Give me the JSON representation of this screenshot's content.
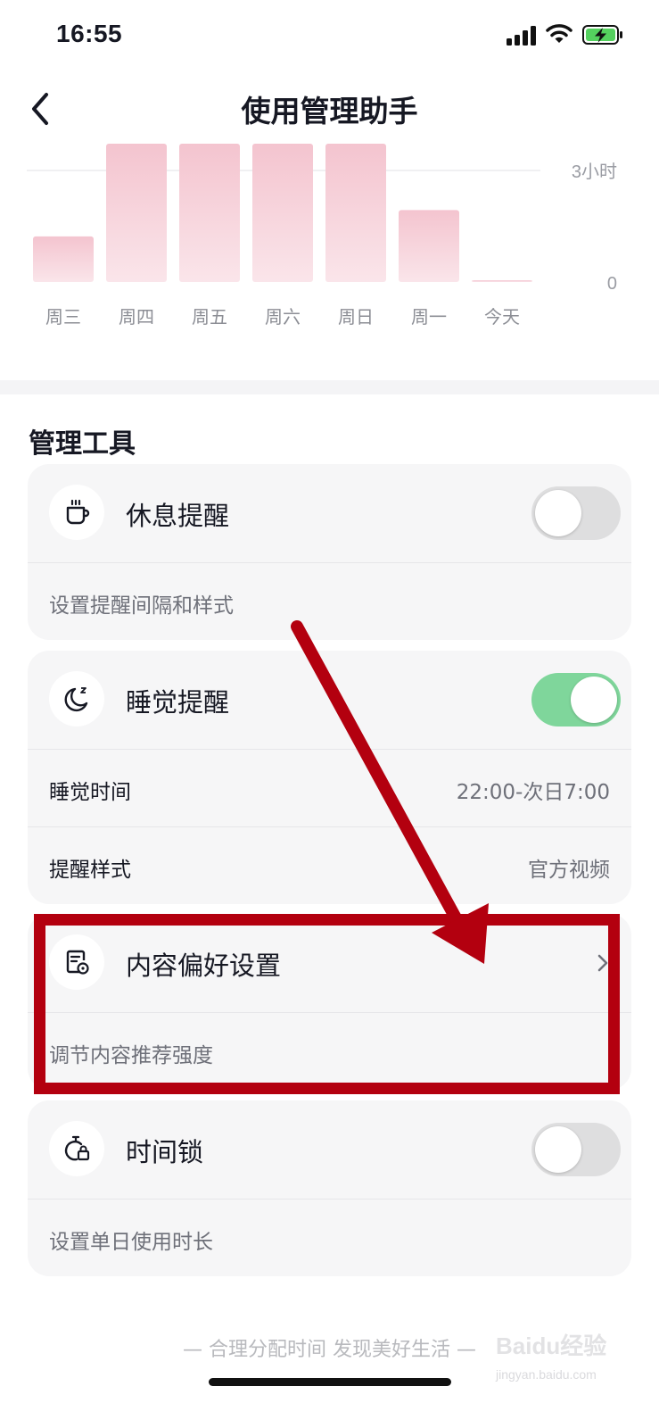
{
  "status_bar": {
    "time": "16:55"
  },
  "nav": {
    "title": "使用管理助手"
  },
  "usage_chart": {
    "y_max_label": "3小时",
    "y_min_label": "0",
    "days": [
      "周三",
      "周四",
      "周五",
      "周六",
      "周日",
      "周一",
      "今天"
    ],
    "values": [
      0.33,
      1.0,
      1.0,
      1.0,
      1.0,
      0.52,
      0.01
    ],
    "bar_color": "#f4c9d3"
  },
  "section": {
    "title": "管理工具"
  },
  "rest_reminder": {
    "title": "休息提醒",
    "subtitle": "设置提醒间隔和样式",
    "enabled": false
  },
  "sleep_reminder": {
    "title": "睡觉提醒",
    "enabled": true,
    "sleep_time_label": "睡觉时间",
    "sleep_time_value": "22:00-次日7:00",
    "style_label": "提醒样式",
    "style_value": "官方视频"
  },
  "content_pref": {
    "title": "内容偏好设置",
    "subtitle": "调节内容推荐强度"
  },
  "time_lock": {
    "title": "时间锁",
    "subtitle": "设置单日使用时长",
    "enabled": false
  },
  "footer": {
    "text": "— 合理分配时间 发现美好生活 —"
  },
  "watermark": {
    "text": "Baidu经验",
    "sub": "jingyan.baidu.com"
  },
  "colors": {
    "toggle_on": "#7fd69b",
    "toggle_off": "#dededf",
    "annotation_red": "#b3000f"
  }
}
